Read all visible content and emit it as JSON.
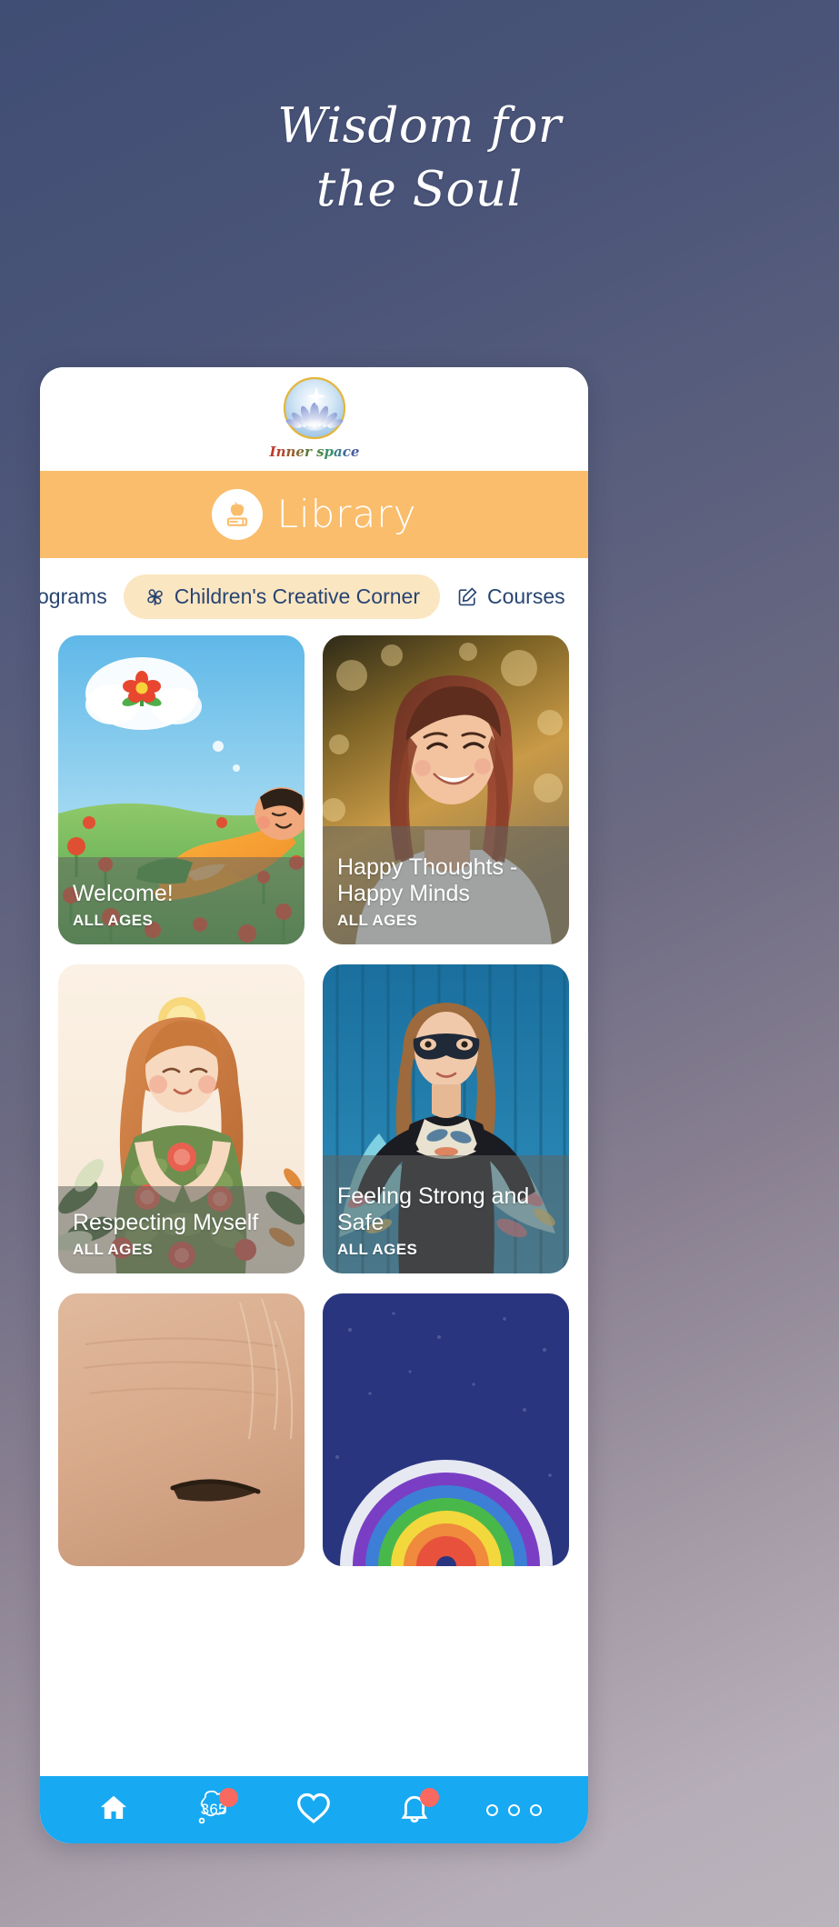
{
  "hero": {
    "line1": "Wisdom for",
    "line2": "the Soul"
  },
  "app": {
    "logo_alt": "Inner space",
    "logo_wordmark": "Inner space",
    "header": {
      "title": "Library",
      "icon": "apple-book-icon",
      "background_color": "#FABD6C"
    }
  },
  "tabs": [
    {
      "label": "Programs",
      "icon": null,
      "active": false
    },
    {
      "label": "Children's Creative Corner",
      "icon": "pinwheel-icon",
      "active": true
    },
    {
      "label": "Courses",
      "icon": "pencil-square-icon",
      "active": false
    }
  ],
  "cards": [
    {
      "title": "Welcome!",
      "meta": "ALL AGES",
      "art": "child-meditating-flower-thought-illustration"
    },
    {
      "title": "Happy Thoughts - Happy Minds",
      "meta": "ALL AGES",
      "art": "smiling-young-woman-sunset-photo"
    },
    {
      "title": "Respecting Myself",
      "meta": "ALL AGES",
      "art": "girl-with-roses-illustration"
    },
    {
      "title": "Feeling Strong and Safe",
      "meta": "ALL AGES",
      "art": "masked-superhero-girl-photo"
    },
    {
      "title": "",
      "meta": "",
      "art": "child-forehead-photo"
    },
    {
      "title": "",
      "meta": "",
      "art": "rainbow-chalk-drawing"
    }
  ],
  "bottom_nav": {
    "background_color": "#17A9F2",
    "items": [
      {
        "name": "home",
        "icon": "home-icon",
        "badge": false,
        "label": ""
      },
      {
        "name": "365",
        "icon": "thought-cloud-icon",
        "badge": true,
        "label": "365"
      },
      {
        "name": "favorites",
        "icon": "heart-icon",
        "badge": false,
        "label": ""
      },
      {
        "name": "notifications",
        "icon": "bell-icon",
        "badge": true,
        "label": ""
      },
      {
        "name": "more",
        "icon": "three-circles-icon",
        "badge": false,
        "label": ""
      }
    ]
  }
}
